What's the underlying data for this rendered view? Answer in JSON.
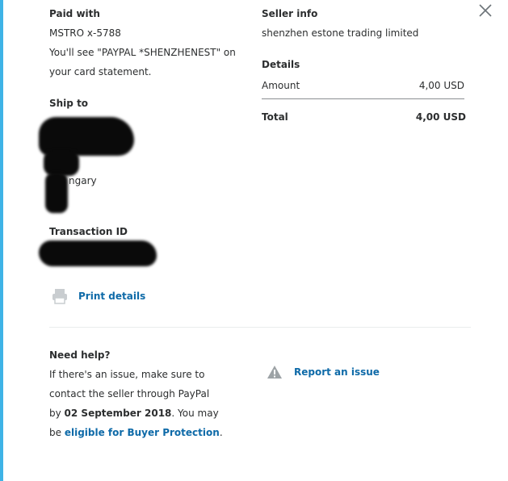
{
  "paid_with": {
    "label": "Paid with",
    "card": "MSTRO x-5788",
    "statement_line1": "You'll see \"PAYPAL *SHENZHENEST\" on",
    "statement_line2": "your card statement."
  },
  "ship_to": {
    "label": "Ship to",
    "visible_text": "ngary"
  },
  "transaction": {
    "label": "Transaction ID"
  },
  "print": {
    "label": "Print details"
  },
  "seller": {
    "label": "Seller info",
    "name": "shenzhen estone trading limited"
  },
  "details": {
    "label": "Details",
    "amount_label": "Amount",
    "amount_value": "4,00 USD",
    "total_label": "Total",
    "total_value": "4,00 USD"
  },
  "help": {
    "title": "Need help?",
    "line1": "If there's an issue, make sure to",
    "line2": "contact the seller through PayPal",
    "line3_prefix": "by ",
    "line3_date": "02 September 2018",
    "line3_suffix": ". You may",
    "line4_prefix": "be ",
    "line4_link": "eligible for Buyer Protection",
    "line4_suffix": ".",
    "report_label": "Report an issue"
  },
  "colors": {
    "accent_bar": "#3eb3e6",
    "link": "#0e6aa8",
    "text": "#2c2e2f"
  }
}
